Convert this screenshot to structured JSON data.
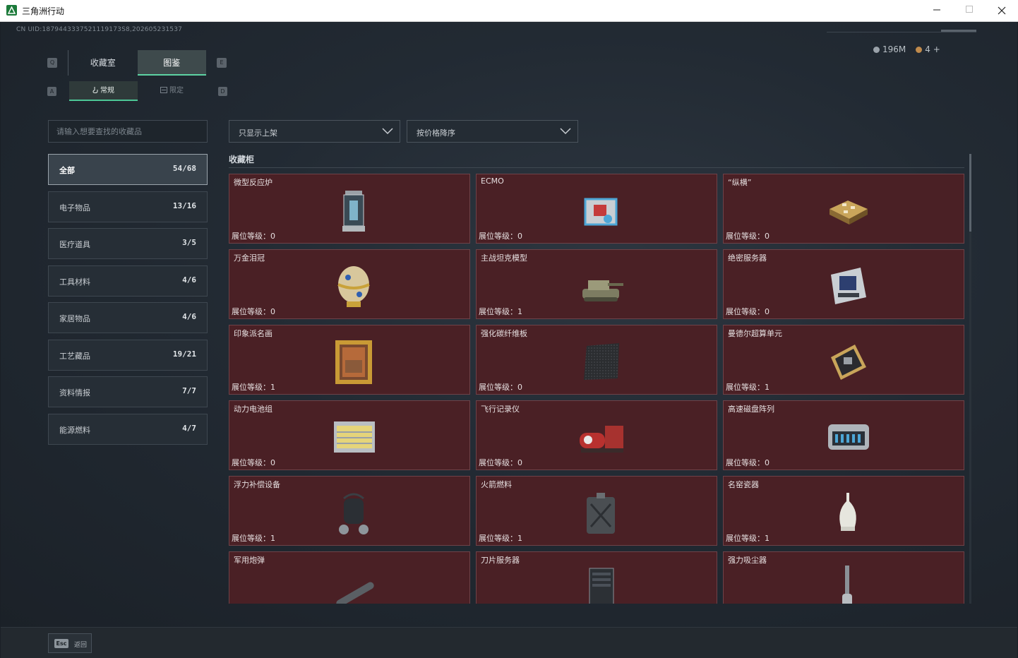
{
  "window": {
    "title": "三角洲行动"
  },
  "uid": "CN UID:1879443337521119173S8,202605231537",
  "currency": {
    "silver": "196M",
    "gold": "4",
    "gold_add": "+"
  },
  "key_hints": {
    "q": "Q",
    "e": "E",
    "a": "A",
    "d": "D"
  },
  "main_tabs": [
    {
      "label": "收藏室"
    },
    {
      "label": "图鉴"
    }
  ],
  "sub_tabs": [
    {
      "label": "常规"
    },
    {
      "label": "限定"
    }
  ],
  "search": {
    "placeholder": "请输入想要查找的收藏品"
  },
  "categories": [
    {
      "label": "全部",
      "count": "54/68"
    },
    {
      "label": "电子物品",
      "count": "13/16"
    },
    {
      "label": "医疗道具",
      "count": "3/5"
    },
    {
      "label": "工具材料",
      "count": "4/6"
    },
    {
      "label": "家居物品",
      "count": "4/6"
    },
    {
      "label": "工艺藏品",
      "count": "19/21"
    },
    {
      "label": "资料情报",
      "count": "7/7"
    },
    {
      "label": "能源燃料",
      "count": "4/7"
    }
  ],
  "filters": {
    "show": "只显示上架",
    "sort": "按价格降序"
  },
  "section_title": "收藏柜",
  "items": [
    {
      "name": "微型反应炉",
      "level": "展位等级：0",
      "icon": "reactor-icon"
    },
    {
      "name": "ECMO",
      "level": "展位等级：0",
      "icon": "ecmo-icon"
    },
    {
      "name": "“纵横”",
      "level": "展位等级：0",
      "icon": "chessboard-icon"
    },
    {
      "name": "万金泪冠",
      "level": "展位等级：0",
      "icon": "jeweled-egg-icon"
    },
    {
      "name": "主战坦克模型",
      "level": "展位等级：1",
      "icon": "tank-model-icon"
    },
    {
      "name": "绝密服务器",
      "level": "展位等级：0",
      "icon": "server-board-icon"
    },
    {
      "name": "印象派名画",
      "level": "展位等级：1",
      "icon": "painting-icon"
    },
    {
      "name": "强化碳纤维板",
      "level": "展位等级：0",
      "icon": "carbon-plate-icon"
    },
    {
      "name": "曼德尔超算单元",
      "level": "展位等级：1",
      "icon": "compute-unit-icon"
    },
    {
      "name": "动力电池组",
      "level": "展位等级：0",
      "icon": "battery-pack-icon"
    },
    {
      "name": "飞行记录仪",
      "level": "展位等级：0",
      "icon": "flight-recorder-icon"
    },
    {
      "name": "高速磁盘阵列",
      "level": "展位等级：0",
      "icon": "disk-array-icon"
    },
    {
      "name": "浮力补偿设备",
      "level": "展位等级：1",
      "icon": "buoyancy-device-icon"
    },
    {
      "name": "火箭燃料",
      "level": "展位等级：1",
      "icon": "fuel-can-icon"
    },
    {
      "name": "名窑瓷器",
      "level": "展位等级：1",
      "icon": "porcelain-vase-icon"
    },
    {
      "name": "军用炮弹",
      "level": "",
      "icon": "artillery-shell-icon"
    },
    {
      "name": "刀片服务器",
      "level": "",
      "icon": "blade-server-icon"
    },
    {
      "name": "强力吸尘器",
      "level": "",
      "icon": "vacuum-cleaner-icon"
    }
  ],
  "bottom": {
    "esc_key": "Esc",
    "esc_label": "返回"
  }
}
